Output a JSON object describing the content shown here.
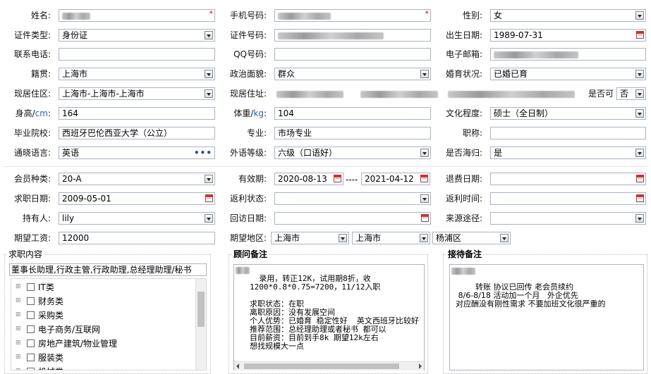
{
  "row1": {
    "name_label": "姓名:",
    "phone_label": "手机号码:",
    "gender_label": "性别:",
    "gender_value": "女",
    "required_mark": "*"
  },
  "row2": {
    "idtype_label": "证件类型:",
    "idtype_value": "身份证",
    "idno_label": "证件号码:",
    "birth_label": "出生日期:",
    "birth_value": "1989-07-31"
  },
  "row3": {
    "tel_label": "联系电话:",
    "qq_label": "QQ号码:",
    "email_label": "电子邮箱:"
  },
  "row4": {
    "native_label": "籍贯:",
    "native_value": "上海市",
    "politics_label": "政治面貌:",
    "politics_value": "群众",
    "marital_label": "婚育状况:",
    "marital_value": "已婚已育"
  },
  "row5": {
    "residence_label": "现居住区:",
    "residence_value": "上海市-上海市-上海市",
    "address_label": "现居住址:",
    "whether_label": "是否可",
    "whether_value": "否"
  },
  "row6": {
    "height_label": "身高/",
    "height_unit": "cm",
    "height_value": "164",
    "weight_label": "体重/",
    "weight_unit": "kg",
    "weight_value": "104",
    "edu_label": "文化程度:",
    "edu_value": "硕士（全日制）"
  },
  "row7": {
    "school_label": "毕业院校:",
    "school_value": "西班牙巴伦西亚大学（公立）",
    "major_label": "专业:",
    "major_value": "市场专业",
    "title_label": "职称:"
  },
  "row8": {
    "lang_label": "通晓语言:",
    "lang_value": "英语",
    "lang_more": "•••",
    "level_label": "外语等级:",
    "level_value": "六级（口语好）",
    "returnee_label": "是否海归:",
    "returnee_value": "是"
  },
  "member": {
    "type_label": "会员种类:",
    "type_value": "20-A",
    "valid_label": "有效期:",
    "valid_from": "2020-08-13",
    "valid_sep": "----",
    "valid_to": "2021-04-12",
    "refund_label": "退费日期:"
  },
  "job": {
    "apply_label": "求职日期:",
    "apply_value": "2009-05-01",
    "rebate_status_label": "返利状态:",
    "rebate_time_label": "返利时间:",
    "holder_label": "持有人:",
    "holder_value": "lily",
    "visit_label": "回访日期:",
    "source_label": "来源途径:",
    "salary_label": "期望工资:",
    "salary_value": "12000",
    "area_label": "期望地区:",
    "area_province": "上海市",
    "area_city": "上海市",
    "area_district": "杨浦区"
  },
  "content": {
    "title": "求职内容",
    "selected": "董事长助理,行政主管,行政助理,总经理助理/秘书",
    "tree": [
      "IT类",
      "财务类",
      "采购类",
      "电子商务/互联网",
      "房地产建筑/物业管理",
      "服装类",
      "机械类"
    ]
  },
  "advisor": {
    "title": "顾问备注",
    "text": "录用，转正12K，试用期8折，收\n1200*0.8*0.75=7200，11/12入职\n\n求职状态：在职\n离职原因：没有发展空间\n个人优势：已婚育 稳定性好  英文西班牙比较好\n推荐范围：总经理助理或者秘书 都可以\n目前薪资：目前到手8k 期望12k左右\n想找规模大一点"
  },
  "reception": {
    "title": "接待备注",
    "text": "转账 协议已回传 老会员续约\n 8/6-8/18 活动加一个月   外企优先\n对应酬没有刚性需求 不要加班文化很严重的"
  },
  "colors": {
    "border": "#a9b4c2",
    "unit_blue": "#2a5fb0",
    "required_red": "#e00000"
  }
}
